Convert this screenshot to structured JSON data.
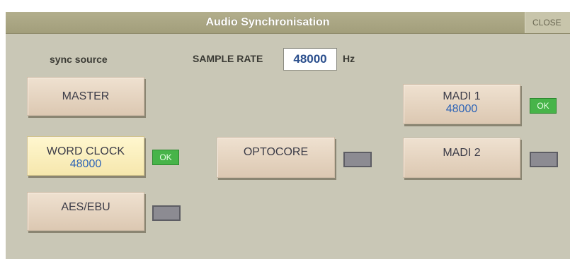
{
  "window": {
    "title": "Audio Synchronisation",
    "close_label": "CLOSE"
  },
  "sync_source_label": "sync source",
  "sample_rate": {
    "label": "SAMPLE RATE",
    "value": "48000",
    "unit": "Hz"
  },
  "sources": {
    "master": {
      "label": "MASTER"
    },
    "word_clock": {
      "label": "WORD CLOCK",
      "value": "48000",
      "status": "OK",
      "selected": true
    },
    "aes_ebu": {
      "label": "AES/EBU"
    },
    "optocore": {
      "label": "OPTOCORE"
    },
    "madi1": {
      "label": "MADI 1",
      "value": "48000",
      "status": "OK"
    },
    "madi2": {
      "label": "MADI 2"
    }
  },
  "colors": {
    "panel": "#c9c7b6",
    "titlebar": "#a9a583",
    "ok_green": "#47b449",
    "led_off": "#8c8b92",
    "value_blue": "#2e64b6"
  }
}
